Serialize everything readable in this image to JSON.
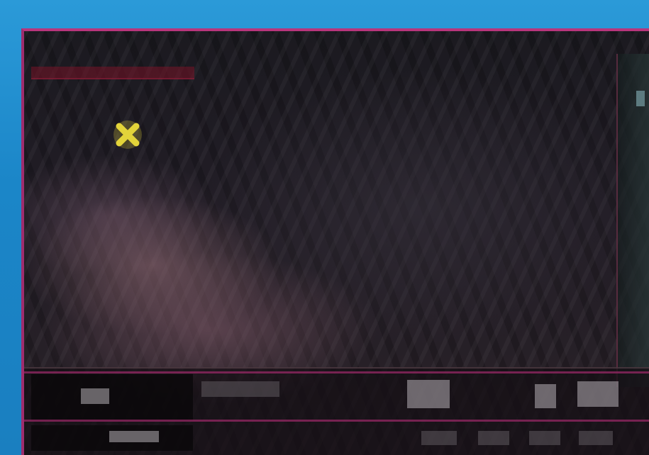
{
  "scene": {
    "marker_icon": "target-x-icon",
    "marker_color": "#e3d43a",
    "frame_color": "#b8357c",
    "background_color": "#1f8fcf"
  }
}
